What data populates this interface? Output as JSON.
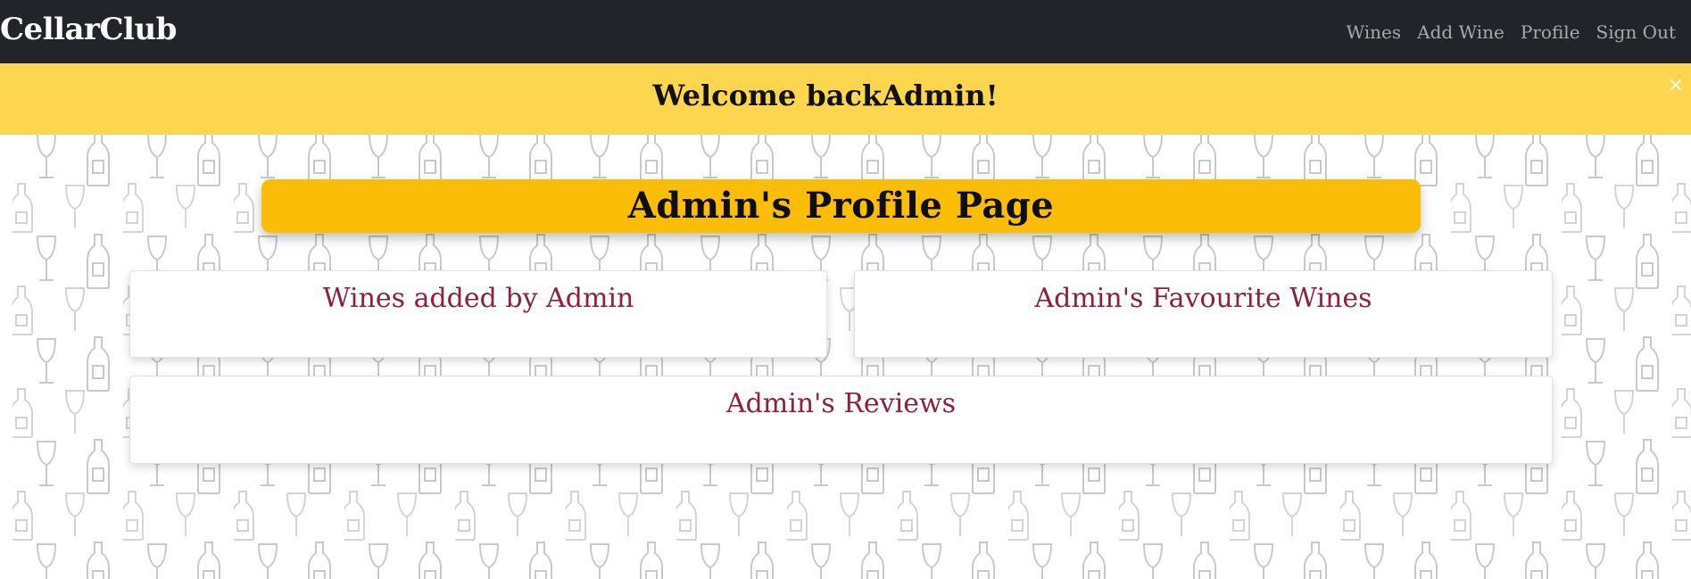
{
  "navbar": {
    "brand": "CellarClub",
    "links": [
      {
        "label": "Wines"
      },
      {
        "label": "Add Wine"
      },
      {
        "label": "Profile"
      },
      {
        "label": "Sign Out"
      }
    ]
  },
  "alert": {
    "message": "Welcome backAdmin!",
    "close_symbol": "×"
  },
  "main": {
    "page_title": "Admin's Profile Page",
    "cards": {
      "added": "Wines added by Admin",
      "favourites": "Admin's Favourite Wines",
      "reviews": "Admin's Reviews"
    }
  },
  "colors": {
    "navbar_bg": "#212529",
    "alert_bg": "#fed54e",
    "title_bg": "#fbbd08",
    "card_title": "#8e2139"
  },
  "icons": {
    "background_pattern": "wine-glass-and-bottle-pattern"
  }
}
